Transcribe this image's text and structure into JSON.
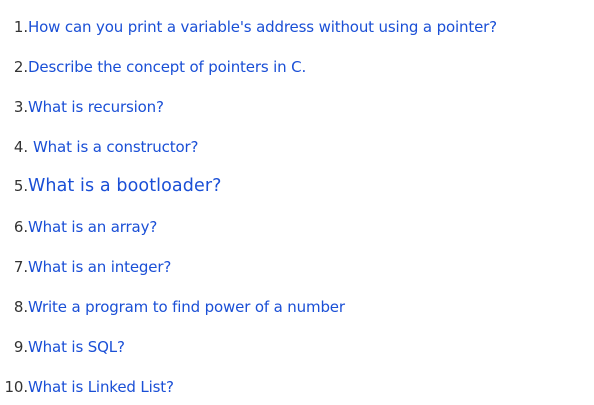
{
  "questions": [
    {
      "number": "1.",
      "text": "How can you print a variable's address without using a pointer?"
    },
    {
      "number": "2.",
      "text": "Describe the concept of pointers in C."
    },
    {
      "number": "3.",
      "text": "What is recursion?"
    },
    {
      "number": "4.",
      "text": "What is a constructor?"
    },
    {
      "number": "5.",
      "text": "What is a bootloader?"
    },
    {
      "number": "6.",
      "text": "What is an array?"
    },
    {
      "number": "7.",
      "text": "What is an integer?"
    },
    {
      "number": "8.",
      "text": "Write a program to find power of a number"
    },
    {
      "number": "9.",
      "text": "What is SQL?"
    },
    {
      "number": "10.",
      "text": "What is Linked List?"
    }
  ],
  "colors": {
    "link": "#1a4fd6",
    "number": "#333333"
  }
}
